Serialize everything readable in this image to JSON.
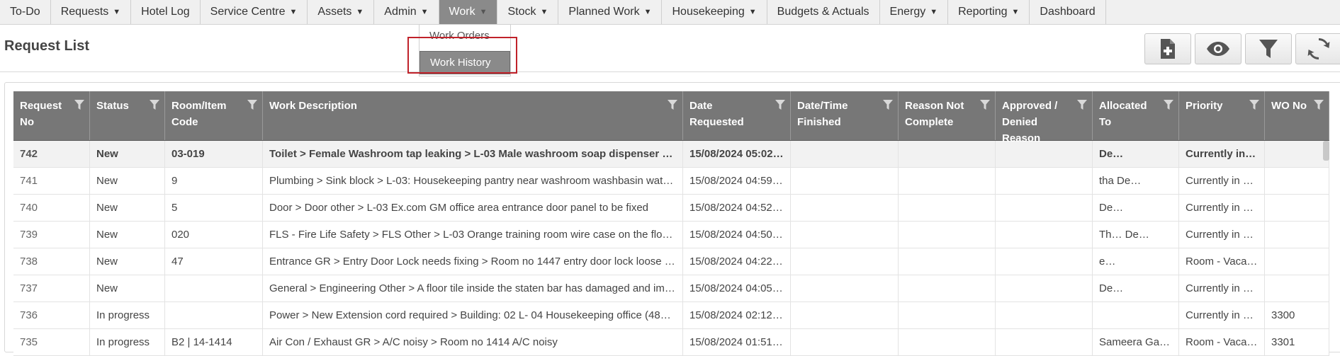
{
  "nav": {
    "items": [
      {
        "label": "To-Do",
        "dropdown": false
      },
      {
        "label": "Requests",
        "dropdown": true
      },
      {
        "label": "Hotel Log",
        "dropdown": false
      },
      {
        "label": "Service Centre",
        "dropdown": true
      },
      {
        "label": "Assets",
        "dropdown": true
      },
      {
        "label": "Admin",
        "dropdown": true
      },
      {
        "label": "Work",
        "dropdown": true,
        "active": true
      },
      {
        "label": "Stock",
        "dropdown": true
      },
      {
        "label": "Planned Work",
        "dropdown": true
      },
      {
        "label": "Housekeeping",
        "dropdown": true
      },
      {
        "label": "Budgets & Actuals",
        "dropdown": false
      },
      {
        "label": "Energy",
        "dropdown": true
      },
      {
        "label": "Reporting",
        "dropdown": true
      },
      {
        "label": "Dashboard",
        "dropdown": false
      }
    ],
    "caret": "▼"
  },
  "work_menu": {
    "items": [
      "Work Orders",
      "Work History"
    ],
    "highlighted": "Work History",
    "highlight_color": "#c0222a"
  },
  "page": {
    "title": "Request List",
    "tools": [
      "add-document-icon",
      "eye-icon",
      "filter-icon",
      "refresh-icon"
    ]
  },
  "grid": {
    "columns": [
      "Request No",
      "Status",
      "Room/Item Code",
      "Work Description",
      "Date Requested",
      "Date/Time Finished",
      "Reason Not Complete",
      "Approved / Denied Reason",
      "Allocated To",
      "Priority",
      "WO No"
    ],
    "rows": [
      {
        "no": "742",
        "status": "New",
        "room": "03-019",
        "desc": "Toilet > Female Washroom tap leaking > L-03 Male washroom soap dispenser …",
        "date": "15/08/2024 05:02…",
        "finished": "",
        "reason": "",
        "approved": "",
        "allocated": "De…",
        "priority": "Currently in…",
        "wo": "",
        "selected": true
      },
      {
        "no": "741",
        "status": "New",
        "room": "9",
        "desc": "Plumbing > Sink block > L-03: Housekeeping pantry near washroom washbasin wat…",
        "date": "15/08/2024 04:59…",
        "finished": "",
        "reason": "",
        "approved": "",
        "allocated": "tha De…",
        "priority": "Currently in …",
        "wo": ""
      },
      {
        "no": "740",
        "status": "New",
        "room": "5",
        "desc": "Door > Door other > L-03 Ex.com GM office area entrance door panel to be fixed",
        "date": "15/08/2024 04:52…",
        "finished": "",
        "reason": "",
        "approved": "",
        "allocated": "De…",
        "priority": "Currently in …",
        "wo": ""
      },
      {
        "no": "739",
        "status": "New",
        "room": "020",
        "desc": "FLS - Fire Life Safety > FLS Other > L-03 Orange training room wire case on the flo…",
        "date": "15/08/2024 04:50…",
        "finished": "",
        "reason": "",
        "approved": "",
        "allocated": "Th… De…",
        "priority": "Currently in …",
        "wo": ""
      },
      {
        "no": "738",
        "status": "New",
        "room": "47",
        "desc": "Entrance GR > Entry Door Lock needs fixing > Room no 1447 entry door lock loose …",
        "date": "15/08/2024 04:22…",
        "finished": "",
        "reason": "",
        "approved": "",
        "allocated": "e…",
        "priority": "Room - Vaca…",
        "wo": ""
      },
      {
        "no": "737",
        "status": "New",
        "room": "",
        "desc": "General > Engineering Other > A floor tile inside the staten bar has damaged and im…",
        "date": "15/08/2024 04:05…",
        "finished": "",
        "reason": "",
        "approved": "",
        "allocated": "De…",
        "priority": "Currently in …",
        "wo": ""
      },
      {
        "no": "736",
        "status": "In progress",
        "room": "",
        "desc": "Power > New Extension cord required > Building: 02 L- 04 Housekeeping office (48…",
        "date": "15/08/2024 02:12…",
        "finished": "",
        "reason": "",
        "approved": "",
        "allocated": "",
        "priority": "Currently in …",
        "wo": "3300"
      },
      {
        "no": "735",
        "status": "In progress",
        "room": "B2 | 14-1414",
        "desc": "Air Con / Exhaust GR > A/C noisy > Room no 1414 A/C noisy",
        "date": "15/08/2024 01:51…",
        "finished": "",
        "reason": "",
        "approved": "",
        "allocated": "Sameera Ga…",
        "priority": "Room - Vaca…",
        "wo": "3301"
      }
    ]
  }
}
